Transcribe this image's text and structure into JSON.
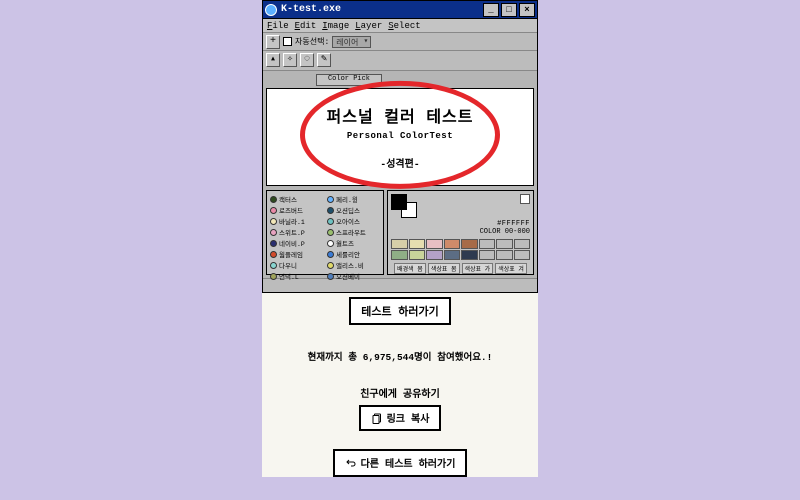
{
  "window": {
    "title": "K-test.exe",
    "menus": [
      "File",
      "Edit",
      "Image",
      "Layer",
      "Select"
    ],
    "toolbar": {
      "auto_select_label": "자동선택:",
      "dropdown": "레이어"
    },
    "palette_label": "Color Pick",
    "card": {
      "headline": "퍼스널 컬러 테스트",
      "subline": "Personal ColorTest",
      "tagline": "-성격편-"
    },
    "layers": [
      {
        "name": "캑터스",
        "color": "#2e4a1e"
      },
      {
        "name": "페리.윙",
        "color": "#66b3ff"
      },
      {
        "name": "로즈버드",
        "color": "#e98aa8"
      },
      {
        "name": "오션딥스",
        "color": "#1e4f6b"
      },
      {
        "name": "바닐라.1",
        "color": "#f2e7b8"
      },
      {
        "name": "오아이스",
        "color": "#6fc3c3"
      },
      {
        "name": "스위트.P",
        "color": "#e7a3c0"
      },
      {
        "name": "스프라우트",
        "color": "#9abf6e"
      },
      {
        "name": "네이비.P",
        "color": "#2a2f70"
      },
      {
        "name": "월트즈",
        "color": "#ffffff"
      },
      {
        "name": "웜플레임",
        "color": "#d24b2c"
      },
      {
        "name": "세룰리안",
        "color": "#3a7bd5"
      },
      {
        "name": "다우니",
        "color": "#88d4cf"
      },
      {
        "name": "앨리스.비",
        "color": "#e0d96b"
      },
      {
        "name": "언덕.L",
        "color": "#9fa35a"
      },
      {
        "name": "오션베이",
        "color": "#4f7ebc"
      }
    ],
    "hex_label": "#FFFFFF",
    "coord_label": "COLOR 00-000",
    "swatches_row1": [
      "#d6cfa8",
      "#e6deb0",
      "#e8bfc3",
      "#cf8b6a",
      "#a76b48",
      "#bcbcbc",
      "#bcbcbc",
      "#bcbcbc"
    ],
    "swatches_row2": [
      "#8fae86",
      "#c8d49a",
      "#b3a1c7",
      "#5c6d84",
      "#2e3a4f",
      "#bcbcbc",
      "#bcbcbc",
      "#bcbcbc"
    ],
    "band_buttons": [
      "배경색 봄",
      "색상표 봄",
      "색상표 가",
      "색상표 겨"
    ]
  },
  "main": {
    "start_button": "테스트 하러가기",
    "count_line": "현재까지 총 6,975,544명이 참여했어요.!",
    "share_header": "친구에게 공유하기",
    "copy_button": "링크 복사",
    "more_button": "다른 테스트 하러가기"
  }
}
